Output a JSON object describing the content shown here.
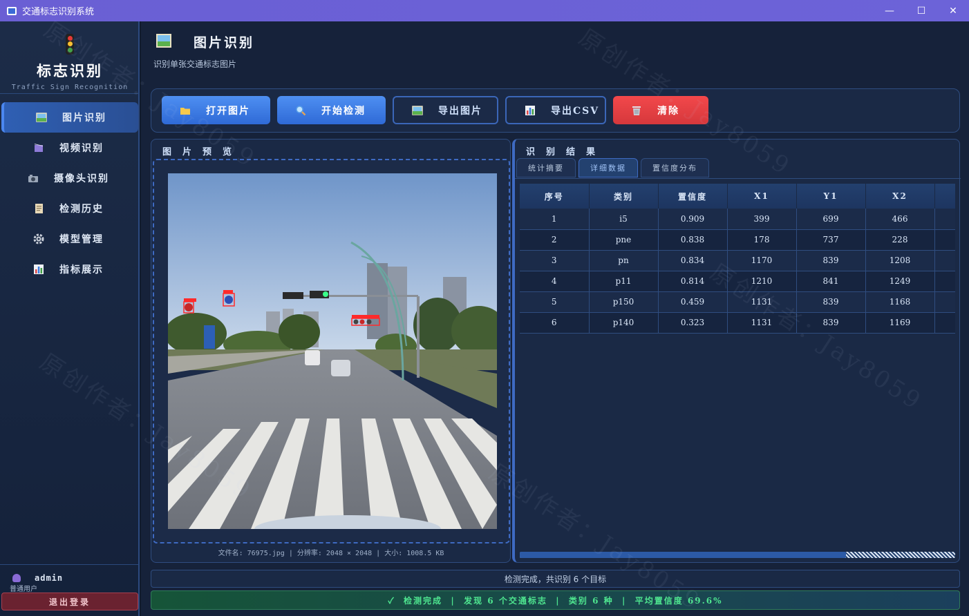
{
  "window": {
    "title": "交通标志识别系统",
    "minimize": "—",
    "maximize": "☐",
    "close": "✕"
  },
  "sidebar": {
    "brand_title": "标志识别",
    "brand_subtitle": "Traffic Sign Recognition",
    "items": [
      {
        "label": "图片识别",
        "icon": "image-icon",
        "active": true
      },
      {
        "label": "视频识别",
        "icon": "video-icon"
      },
      {
        "label": "摄像头识别",
        "icon": "camera-icon"
      },
      {
        "label": "检测历史",
        "icon": "history-icon"
      },
      {
        "label": "模型管理",
        "icon": "gear-icon"
      },
      {
        "label": "指标展示",
        "icon": "chart-icon"
      }
    ],
    "user": {
      "name": "admin",
      "role": "普通用户"
    },
    "logout_label": "退出登录"
  },
  "header": {
    "title": "图片识别",
    "subtitle": "识别单张交通标志图片"
  },
  "toolbar": {
    "open_label": "打开图片",
    "detect_label": "开始检测",
    "export_image_label": "导出图片",
    "export_csv_label": "导出CSV",
    "clear_label": "清除"
  },
  "preview": {
    "title": "图片预览",
    "file_info": "文件名: 76975.jpg  |  分辨率: 2048 × 2048  |  大小: 1008.5 KB"
  },
  "results": {
    "title": "识别结果",
    "tabs": [
      "统计摘要",
      "详细数据",
      "置信度分布"
    ],
    "active_tab": 1,
    "columns": [
      "序号",
      "类别",
      "置信度",
      "X1",
      "Y1",
      "X2"
    ],
    "rows": [
      [
        "1",
        "i5",
        "0.909",
        "399",
        "699",
        "466"
      ],
      [
        "2",
        "pne",
        "0.838",
        "178",
        "737",
        "228"
      ],
      [
        "3",
        "pn",
        "0.834",
        "1170",
        "839",
        "1208"
      ],
      [
        "4",
        "p11",
        "0.814",
        "1210",
        "841",
        "1249"
      ],
      [
        "5",
        "p150",
        "0.459",
        "1131",
        "839",
        "1168"
      ],
      [
        "6",
        "p140",
        "0.323",
        "1131",
        "839",
        "1169"
      ]
    ]
  },
  "status": {
    "message": "检测完成，共识别 6 个目标",
    "summary": "✓  检测完成  |  发现 6 个交通标志  |  类别 6 种  |  平均置信度 69.6%"
  },
  "watermark": "原创作者：Jay8059",
  "colors": {
    "accent": "#2f6ad6",
    "danger": "#e0403f",
    "success": "#4ee58f",
    "background": "#16223a"
  }
}
